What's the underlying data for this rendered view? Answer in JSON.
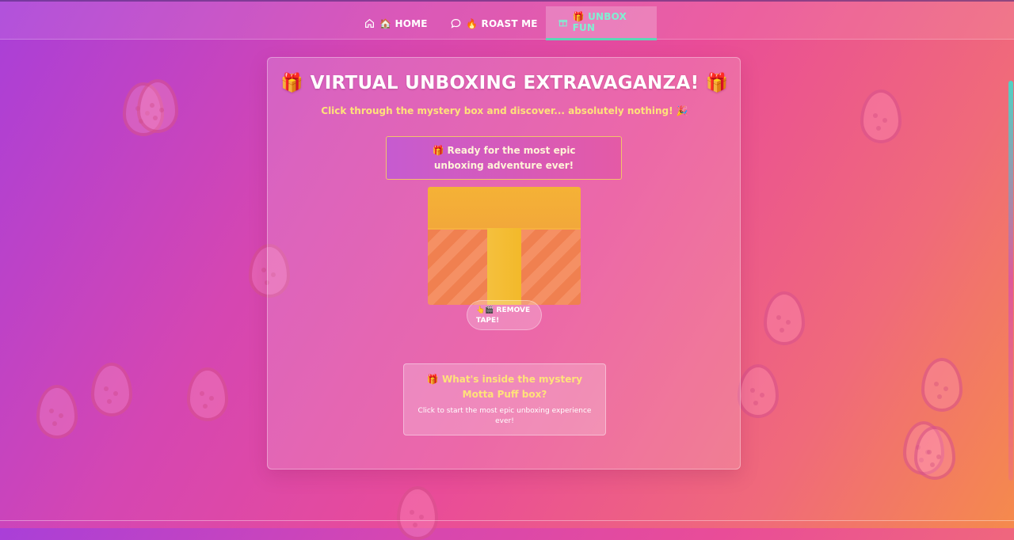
{
  "nav": {
    "tabs": [
      {
        "icon": "home-icon",
        "label": "🏠 HOME"
      },
      {
        "icon": "chat-bubble-icon",
        "label": "🔥 ROAST ME"
      },
      {
        "icon": "gift-icon",
        "label": "🎁 UNBOX FUN"
      }
    ],
    "active_tab": "UNBOX FUN"
  },
  "card": {
    "title": "🎁 VIRTUAL UNBOXING EXTRAVAGANZA! 🎁",
    "subtitle": "Click through the mystery box and discover... absolutely nothing! 🎉",
    "status": "🎁 Ready for the most epic unboxing adventure ever!",
    "tape_button": "👆🎬 REMOVE TAPE!",
    "mystery_title": "🎁 What's inside the mystery Motta Puff box?",
    "mystery_desc": "Click to start the most epic unboxing experience ever!"
  },
  "colors": {
    "accent_active_tab": "#7ff0d2",
    "highlight_text": "#ffe27a",
    "box_lid": "#f5b236",
    "box_body": "#f08050"
  }
}
